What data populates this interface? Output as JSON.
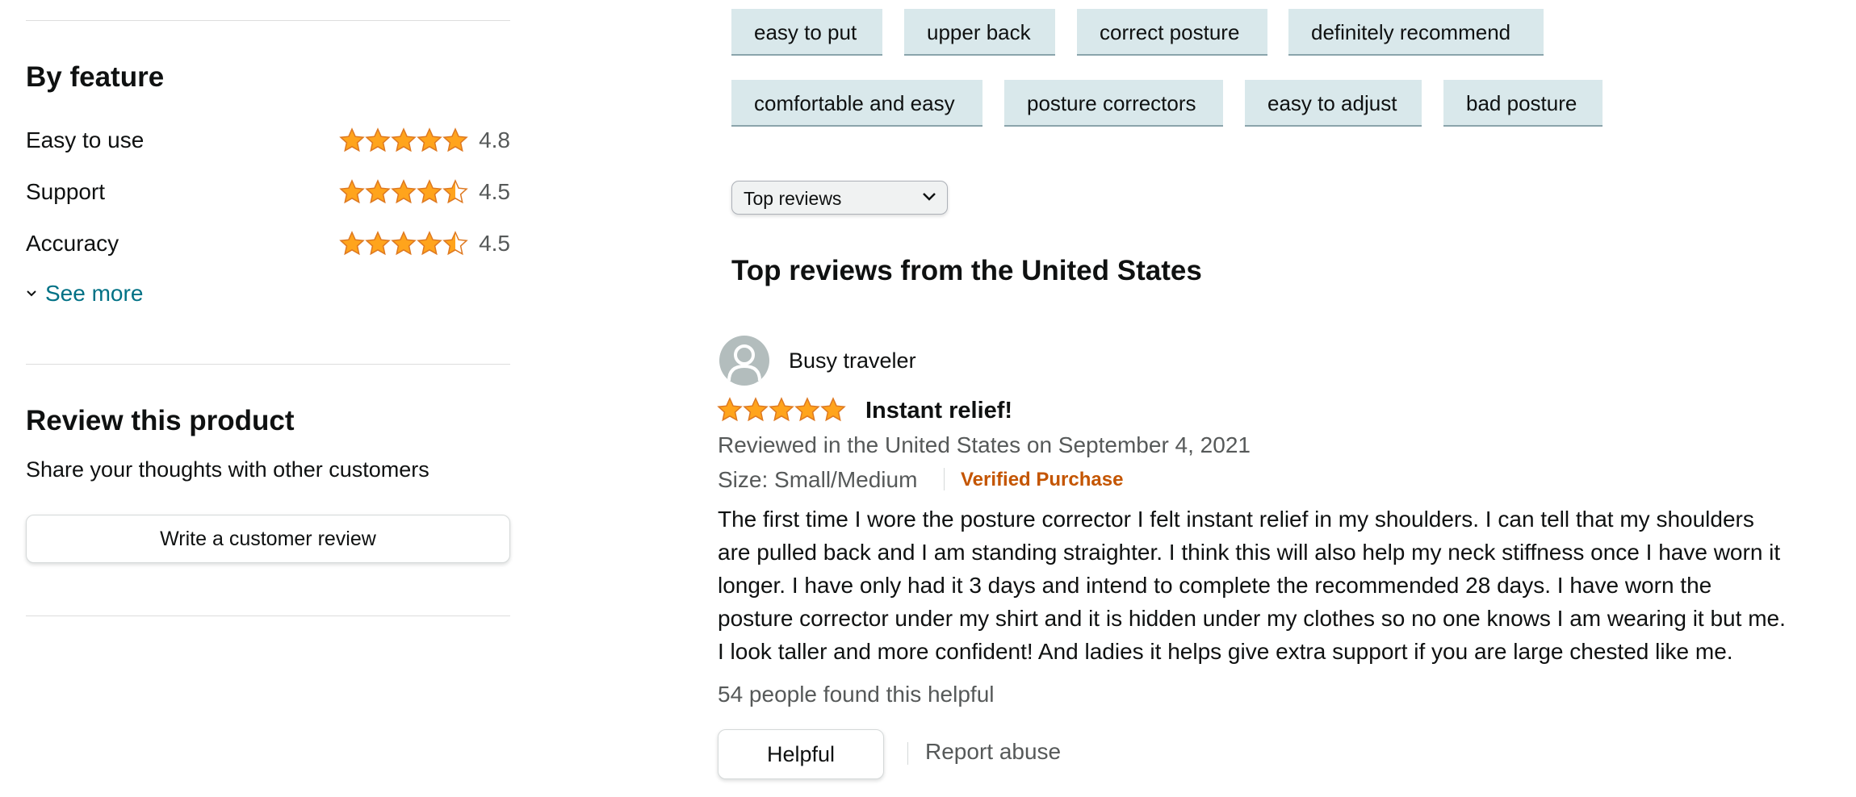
{
  "sidebar": {
    "by_feature_title": "By feature",
    "features": [
      {
        "name": "Easy to use",
        "rating": 4.8,
        "rating_label": "4.8"
      },
      {
        "name": "Support",
        "rating": 4.5,
        "rating_label": "4.5"
      },
      {
        "name": "Accuracy",
        "rating": 4.5,
        "rating_label": "4.5"
      }
    ],
    "see_more": "See more",
    "review_title": "Review this product",
    "review_subtitle": "Share your thoughts with other customers",
    "write_review_button": "Write a customer review"
  },
  "keyword_chips": [
    "easy to put",
    "upper back",
    "correct posture",
    "definitely recommend",
    "comfortable and easy",
    "posture correctors",
    "easy to adjust",
    "bad posture"
  ],
  "sort": {
    "selected": "Top reviews"
  },
  "reviews_heading": "Top reviews from the United States",
  "review": {
    "author": "Busy traveler",
    "rating": 5,
    "title": "Instant relief!",
    "date_line": "Reviewed in the United States on September 4, 2021",
    "size": "Size: Small/Medium",
    "verified": "Verified Purchase",
    "body_lines": [
      "The first time I wore the posture corrector I felt instant relief in my shoulders. I can tell that my shoulders",
      "are pulled back and I am standing straighter. I think this will also help my neck stiffness once I have worn it",
      "longer. I have only had it 3 days and intend to complete the recommended 28 days. I have worn the",
      "posture corrector under my shirt and it is hidden under my clothes so no one knows I am wearing it but me.",
      "I look taller and more confident! And ladies it helps give extra support if you are large chested like me."
    ],
    "helpful_count": "54 people found this helpful",
    "helpful_button": "Helpful",
    "report_abuse": "Report abuse"
  },
  "colors": {
    "star": "#ffa41c",
    "star_stroke": "#de7921",
    "link": "#007185",
    "verified": "#c45500",
    "chip_bg": "#d9e8eb"
  }
}
